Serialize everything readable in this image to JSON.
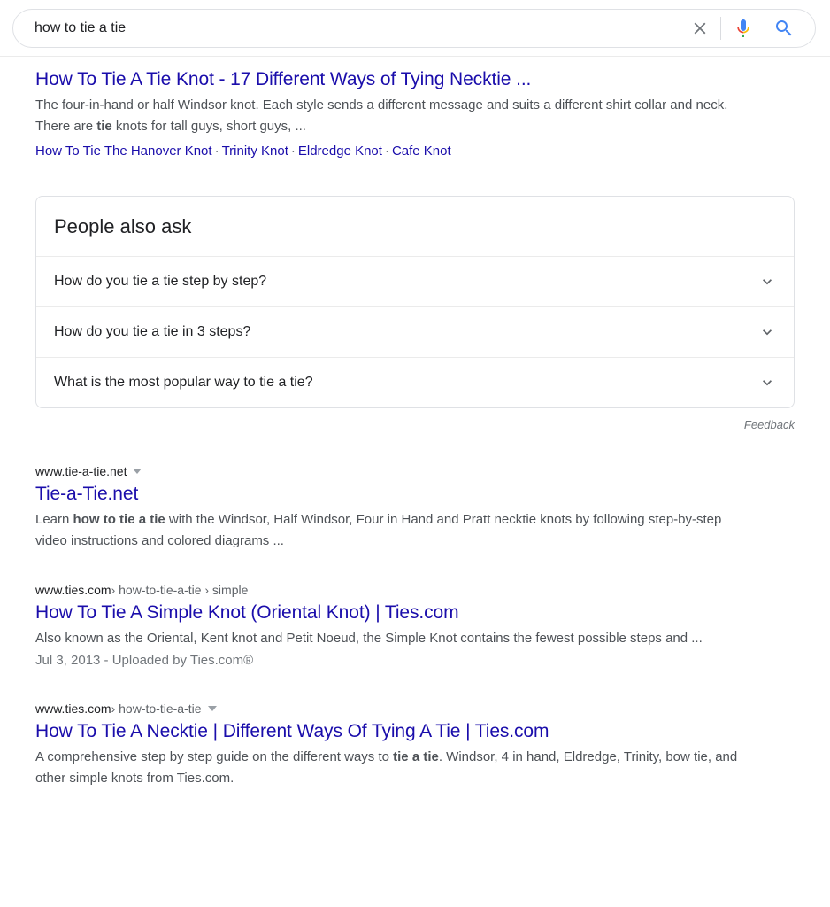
{
  "search": {
    "query": "how to tie a tie",
    "placeholder": "Search",
    "clear_label": "Clear",
    "mic_label": "Search by voice",
    "search_label": "Google Search"
  },
  "results": [
    {
      "title": "How To Tie A Tie Knot - 17 Different Ways of Tying Necktie ...",
      "snippet_parts": [
        {
          "text": "The four-in-hand or half Windsor knot. Each style sends a different message and suits a different shirt collar and neck. There are ",
          "bold": false
        },
        {
          "text": "tie",
          "bold": true
        },
        {
          "text": " knots for tall guys, short guys, ...",
          "bold": false
        }
      ],
      "sitelinks": [
        "How To Tie The Hanover Knot",
        "Trinity Knot",
        "Eldredge Knot",
        "Cafe Knot"
      ],
      "sitelink_separator": "·"
    },
    {
      "url_host": "www.tie-a-tie.net",
      "url_path": "",
      "has_caret": true,
      "title": "Tie-a-Tie.net",
      "snippet_parts": [
        {
          "text": "Learn ",
          "bold": false
        },
        {
          "text": "how to tie a tie",
          "bold": true
        },
        {
          "text": " with the Windsor, Half Windsor, Four in Hand and Pratt necktie knots by following step-by-step video instructions and colored diagrams ...",
          "bold": false
        }
      ]
    },
    {
      "url_host": "www.ties.com",
      "url_path": " › how-to-tie-a-tie › simple",
      "has_caret": false,
      "title": "How To Tie A Simple Knot (Oriental Knot) | Ties.com",
      "snippet_parts": [
        {
          "text": "Also known as the Oriental, Kent knot and Petit Noeud, the Simple Knot contains the fewest possible steps and ...",
          "bold": false
        }
      ],
      "date": "Jul 3, 2013 - Uploaded by Ties.com®"
    },
    {
      "url_host": "www.ties.com",
      "url_path": " › how-to-tie-a-tie",
      "has_caret": true,
      "title": "How To Tie A Necktie | Different Ways Of Tying A Tie | Ties.com",
      "snippet_parts": [
        {
          "text": "A comprehensive step by step guide on the different ways to ",
          "bold": false
        },
        {
          "text": "tie a tie",
          "bold": true
        },
        {
          "text": ". Windsor, 4 in hand, Eldredge, Trinity, bow tie, and other simple knots from Ties.com.",
          "bold": false
        }
      ]
    }
  ],
  "people_also_ask": {
    "heading": "People also ask",
    "questions": [
      "How do you tie a tie step by step?",
      "How do you tie a tie in 3 steps?",
      "What is the most popular way to tie a tie?"
    ],
    "feedback_label": "Feedback"
  },
  "colors": {
    "link": "#1a0dab",
    "snippet": "#4d5156",
    "url_host": "#202124",
    "url_path": "#5f6368",
    "muted": "#70757a",
    "border": "#dfe1e5",
    "mic_blue": "#4285f4",
    "mic_red": "#ea4335",
    "mic_yellow": "#fbbc05",
    "mic_green": "#34a853",
    "search_blue": "#4285f4"
  }
}
